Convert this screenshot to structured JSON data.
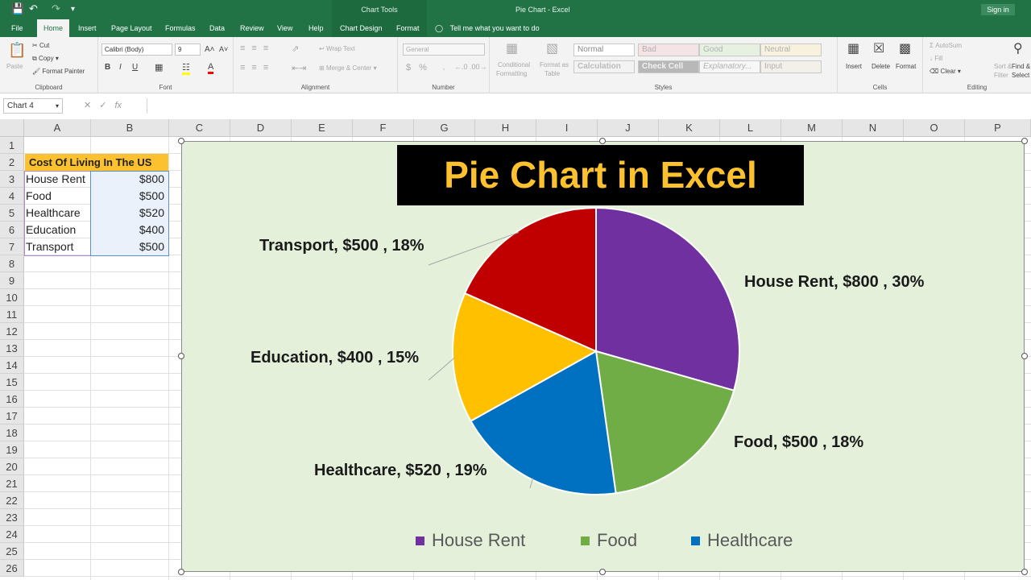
{
  "titlebar": {
    "context_title": "Chart Tools",
    "app_title": "Pie Chart  -  Excel",
    "signin": "Sign in"
  },
  "tabs": [
    "File",
    "Home",
    "Insert",
    "Page Layout",
    "Formulas",
    "Data",
    "Review",
    "View",
    "Help",
    "Chart Design",
    "Format"
  ],
  "active_tab": "Home",
  "tellme": "Tell me what you want to do",
  "ribbon": {
    "clipboard": {
      "paste": "Paste",
      "cut": "Cut",
      "copy": "Copy",
      "format_painter": "Format Painter",
      "name": "Clipboard"
    },
    "font": {
      "family": "Calibri (Body)",
      "size": "9",
      "name": "Font"
    },
    "alignment": {
      "wrap": "Wrap Text",
      "merge": "Merge & Center",
      "name": "Alignment"
    },
    "number": {
      "format": "General",
      "name": "Number"
    },
    "styles": {
      "conditional": "Conditional",
      "formatting": "Formatting",
      "format_as": "Format as",
      "table": "Table",
      "cells": [
        "Normal",
        "Bad",
        "Good",
        "Neutral",
        "Calculation",
        "Check Cell",
        "Explanatory...",
        "Input"
      ],
      "name": "Styles"
    },
    "cells": {
      "insert": "Insert",
      "delete": "Delete",
      "format": "Format",
      "name": "Cells"
    },
    "editing": {
      "autosum": "AutoSum",
      "fill": "Fill",
      "clear": "Clear",
      "sort": "Sort &",
      "filter": "Filter",
      "find": "Find &",
      "select": "Select",
      "name": "Editing"
    }
  },
  "formula_bar": {
    "name_box": "Chart 4",
    "fx": "fx"
  },
  "columns": [
    "A",
    "B",
    "C",
    "D",
    "E",
    "F",
    "G",
    "H",
    "I",
    "J",
    "K",
    "L",
    "M",
    "N",
    "O",
    "P"
  ],
  "rows": [
    "1",
    "2",
    "3",
    "4",
    "5",
    "6",
    "7",
    "8",
    "9",
    "10",
    "11",
    "12",
    "13",
    "14",
    "15",
    "16",
    "17",
    "18",
    "19",
    "20",
    "21",
    "22",
    "23",
    "24",
    "25",
    "26"
  ],
  "table": {
    "header": "Cost Of Living In The US",
    "items": [
      {
        "label": "House Rent",
        "value": "$800"
      },
      {
        "label": "Food",
        "value": "$500"
      },
      {
        "label": "Healthcare",
        "value": "$520"
      },
      {
        "label": "Education",
        "value": "$400"
      },
      {
        "label": "Transport",
        "value": "$500"
      }
    ]
  },
  "chart_data": {
    "type": "pie",
    "title": "Pie Chart in Excel",
    "slices": [
      {
        "name": "House Rent",
        "value": 800,
        "label": "House Rent, $800 , 30%",
        "color": "#7030a0"
      },
      {
        "name": "Food",
        "value": 500,
        "label": "Food, $500 , 18%",
        "color": "#70ad47"
      },
      {
        "name": "Healthcare",
        "value": 520,
        "label": "Healthcare, $520 , 19%",
        "color": "#0070c0"
      },
      {
        "name": "Education",
        "value": 400,
        "label": "Education, $400 , 15%",
        "color": "#ffc000"
      },
      {
        "name": "Transport",
        "value": 500,
        "label": "Transport, $500 , 18%",
        "color": "#c00000"
      }
    ],
    "legend": [
      "House Rent",
      "Food",
      "Healthcare"
    ],
    "legend_position": "bottom"
  },
  "colors": {
    "excel_green": "#217346",
    "chart_bg": "#e4f0da",
    "title_bg": "#000000",
    "title_text": "#fcc12e",
    "header_fill": "#fcc12e"
  }
}
